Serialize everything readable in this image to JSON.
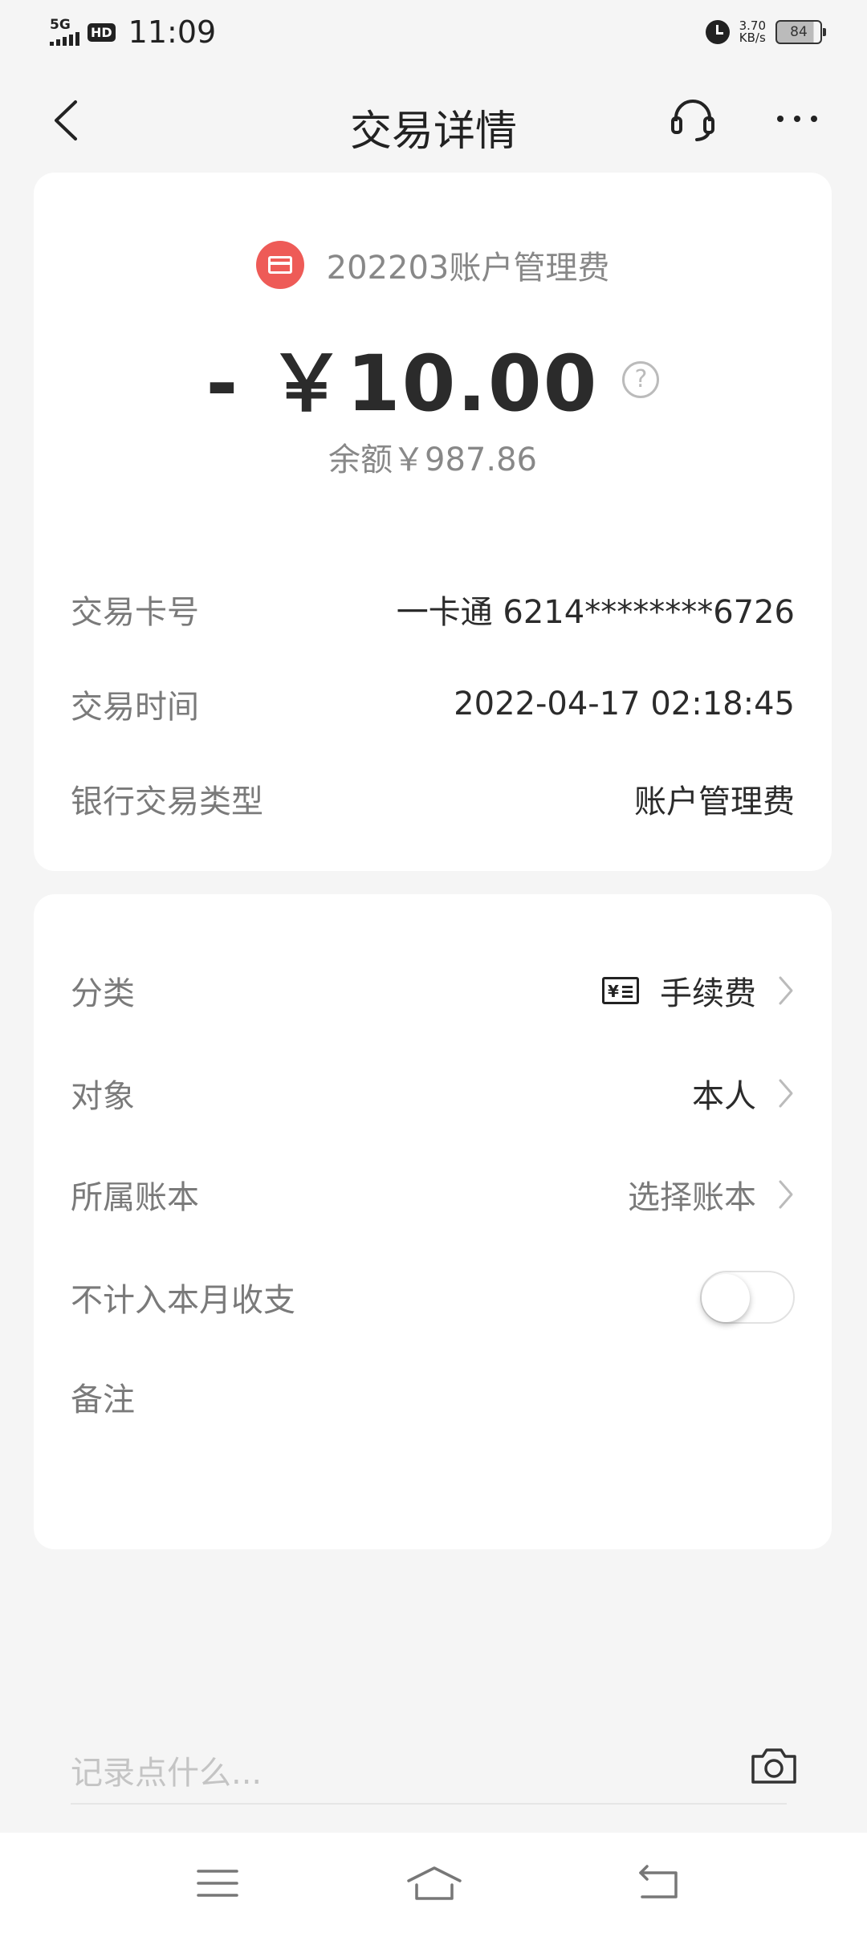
{
  "status_bar": {
    "network": "5G",
    "hd": "HD",
    "time": "11:09",
    "net_speed": "3.70",
    "net_unit": "KB/s",
    "battery": "84"
  },
  "header": {
    "title": "交易详情",
    "back_icon": "chevron-left-icon",
    "service_icon": "headset-icon",
    "more_icon": "more-dots-icon"
  },
  "summary": {
    "merchant_name": "202203账户管理费",
    "merchant_icon": "card-icon",
    "merchant_icon_color": "#ee5b57",
    "amount": "- ￥10.00",
    "help_icon": "?",
    "balance": "余额￥987.86"
  },
  "details": [
    {
      "label": "交易卡号",
      "value": "一卡通 6214********6726"
    },
    {
      "label": "交易时间",
      "value": "2022-04-17 02:18:45"
    },
    {
      "label": "银行交易类型",
      "value": "账户管理费"
    }
  ],
  "options": {
    "category": {
      "label": "分类",
      "value": "手续费",
      "icon_text": "¥"
    },
    "target": {
      "label": "对象",
      "value": "本人"
    },
    "ledger": {
      "label": "所属账本",
      "value": "选择账本"
    },
    "exclude": {
      "label": "不计入本月收支",
      "enabled": false
    },
    "note": {
      "label": "备注",
      "placeholder": "记录点什么..."
    }
  },
  "nav": [
    "menu-icon",
    "home-icon",
    "back-icon"
  ]
}
